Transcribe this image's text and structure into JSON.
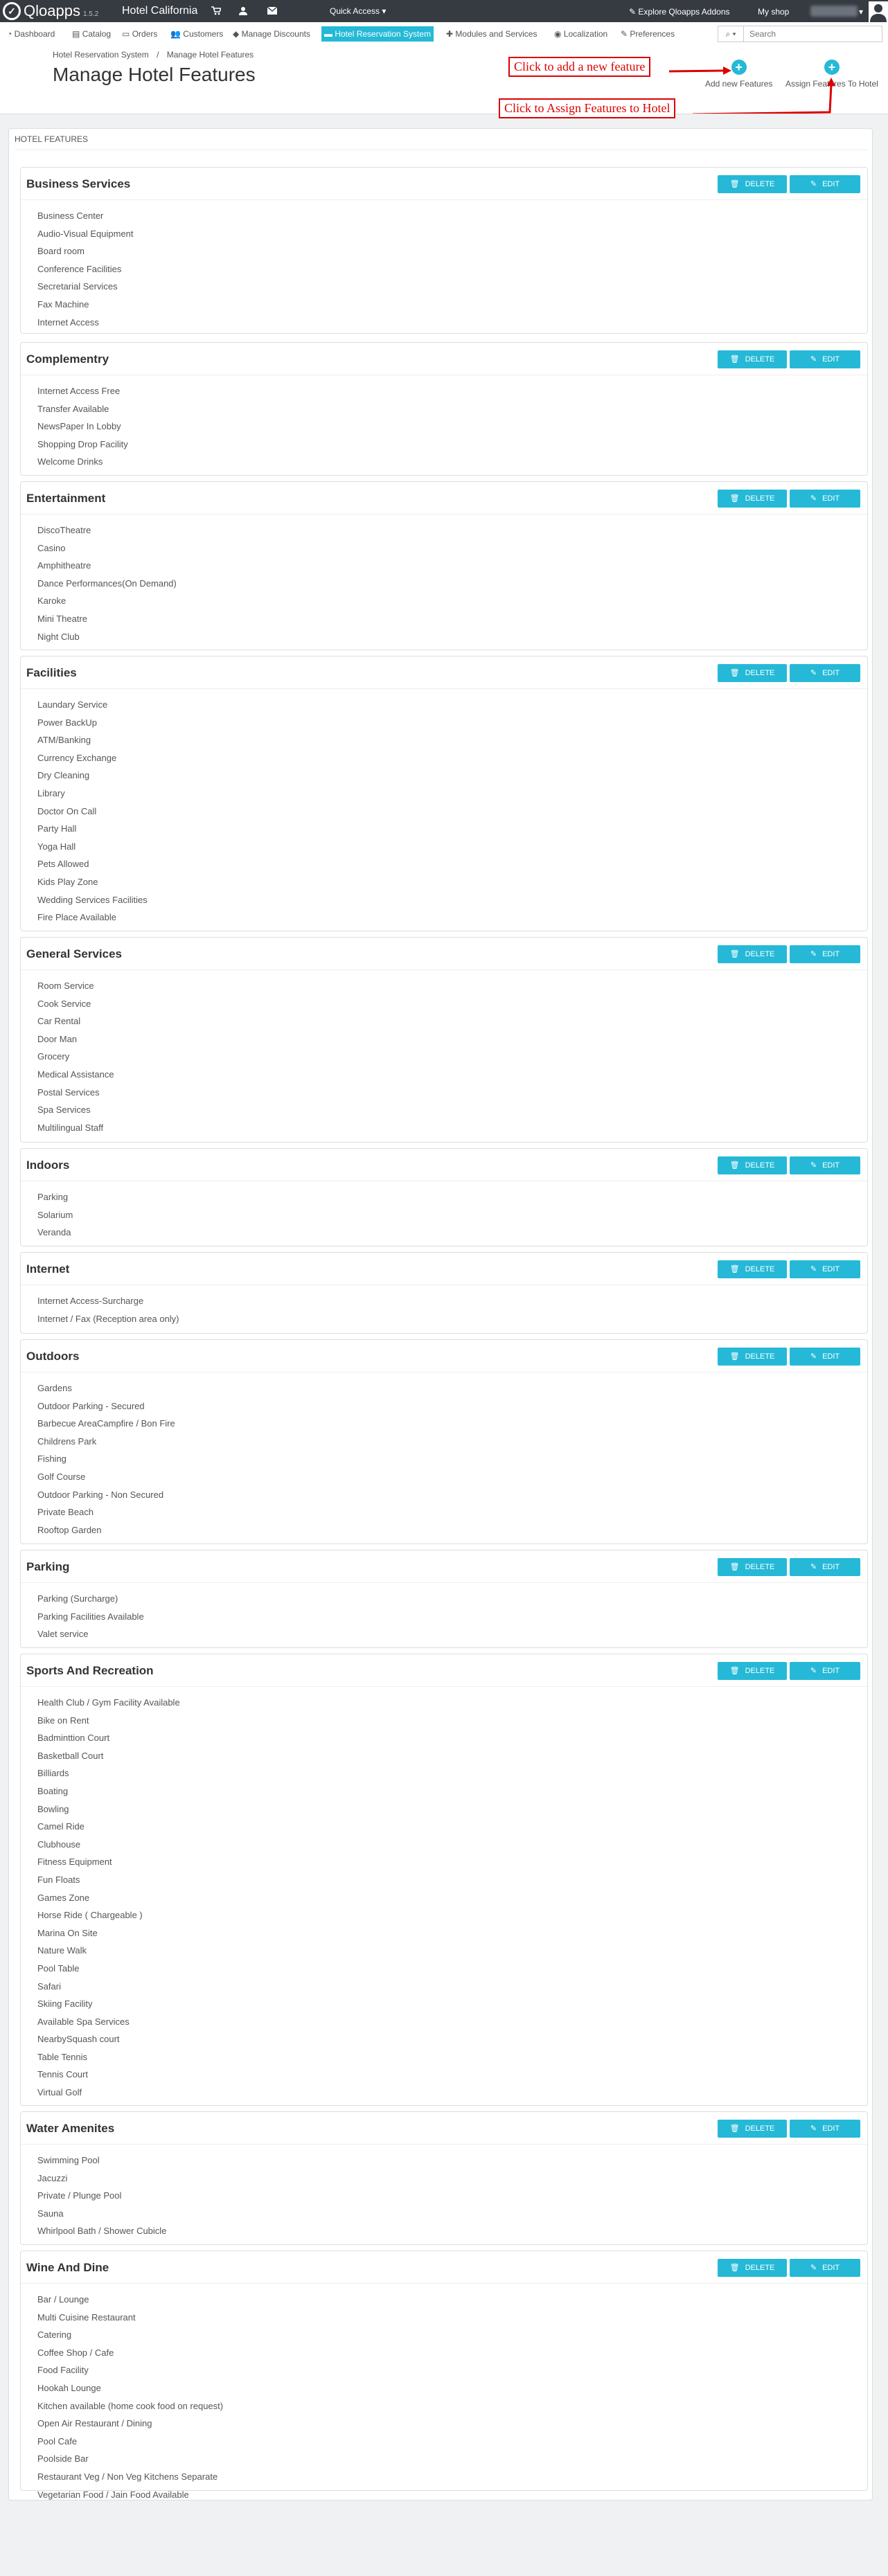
{
  "topbar": {
    "logo_text": "Qloapps",
    "version": "1.5.2",
    "shop_name": "Hotel California",
    "quick_access": "Quick Access",
    "explore_addons": "Explore Qloapps Addons",
    "my_shop": "My shop"
  },
  "nav": {
    "items": [
      "Dashboard",
      "Catalog",
      "Orders",
      "Customers",
      "Manage Discounts",
      "Hotel Reservation System",
      "Modules and Services",
      "Localization",
      "Preferences"
    ],
    "search_placeholder": "Search"
  },
  "breadcrumb": [
    "Hotel Reservation System",
    "Manage Hotel Features"
  ],
  "page_title": "Manage Hotel Features",
  "toolbar": {
    "add_new": "Add new Features",
    "assign": "Assign Features To Hotel"
  },
  "callouts": {
    "add": "Click to add a new feature",
    "assign": "Click to Assign Features to Hotel"
  },
  "panel_heading": "HOTEL FEATURES",
  "buttons": {
    "delete": "DELETE",
    "edit": "EDIT"
  },
  "colors": {
    "accent": "#25b9d7",
    "topbar": "#363a41",
    "callout": "#dd0000"
  },
  "sections": [
    {
      "title": "Business Services",
      "items": [
        "Business Center",
        "Audio-Visual Equipment",
        "Board room",
        "Conference Facilities",
        "Secretarial Services",
        "Fax Machine",
        "Internet Access"
      ]
    },
    {
      "title": "Complementry",
      "items": [
        "Internet Access Free",
        "Transfer Available",
        "NewsPaper In Lobby",
        "Shopping Drop Facility",
        "Welcome Drinks"
      ]
    },
    {
      "title": "Entertainment",
      "items": [
        "DiscoTheatre",
        "Casino",
        "Amphitheatre",
        "Dance Performances(On Demand)",
        "Karoke",
        "Mini Theatre",
        "Night Club"
      ]
    },
    {
      "title": "Facilities",
      "items": [
        "Laundary Service",
        "Power BackUp",
        "ATM/Banking",
        "Currency Exchange",
        "Dry Cleaning",
        "Library",
        "Doctor On Call",
        "Party Hall",
        "Yoga Hall",
        "Pets Allowed",
        "Kids Play Zone",
        "Wedding Services Facilities",
        "Fire Place Available"
      ]
    },
    {
      "title": "General Services",
      "items": [
        "Room Service",
        "Cook Service",
        "Car Rental",
        "Door Man",
        "Grocery",
        "Medical Assistance",
        "Postal Services",
        "Spa Services",
        "Multilingual Staff"
      ]
    },
    {
      "title": "Indoors",
      "items": [
        "Parking",
        "Solarium",
        "Veranda"
      ]
    },
    {
      "title": "Internet",
      "items": [
        "Internet Access-Surcharge",
        "Internet / Fax (Reception area only)"
      ]
    },
    {
      "title": "Outdoors",
      "items": [
        "Gardens",
        "Outdoor Parking - Secured",
        "Barbecue AreaCampfire / Bon Fire",
        "Childrens Park",
        "Fishing",
        "Golf Course",
        "Outdoor Parking - Non Secured",
        "Private Beach",
        "Rooftop Garden"
      ]
    },
    {
      "title": "Parking",
      "items": [
        "Parking (Surcharge)",
        "Parking Facilities Available",
        "Valet service"
      ]
    },
    {
      "title": "Sports And Recreation",
      "items": [
        "Health Club / Gym Facility Available",
        "Bike on Rent",
        "Badminttion Court",
        "Basketball Court",
        "Billiards",
        "Boating",
        "Bowling",
        "Camel Ride",
        "Clubhouse",
        "Fitness Equipment",
        "Fun Floats",
        "Games Zone",
        "Horse Ride ( Chargeable )",
        "Marina On Site",
        "Nature Walk",
        "Pool Table",
        "Safari",
        "Skiing Facility",
        "Available Spa Services",
        "NearbySquash court",
        "Table Tennis",
        "Tennis Court",
        "Virtual Golf"
      ]
    },
    {
      "title": "Water Amenites",
      "items": [
        "Swimming Pool",
        "Jacuzzi",
        "Private / Plunge Pool",
        "Sauna",
        "Whirlpool Bath / Shower Cubicle"
      ]
    },
    {
      "title": "Wine And Dine",
      "items": [
        "Bar / Lounge",
        "Multi Cuisine Restaurant",
        "Catering",
        "Coffee Shop / Cafe",
        "Food Facility",
        "Hookah Lounge",
        "Kitchen available (home cook food on request)",
        "Open Air Restaurant / Dining",
        "Pool Cafe",
        "Poolside Bar",
        "Restaurant Veg / Non Veg Kitchens Separate",
        "Vegetarian Food / Jain Food Available"
      ]
    }
  ]
}
